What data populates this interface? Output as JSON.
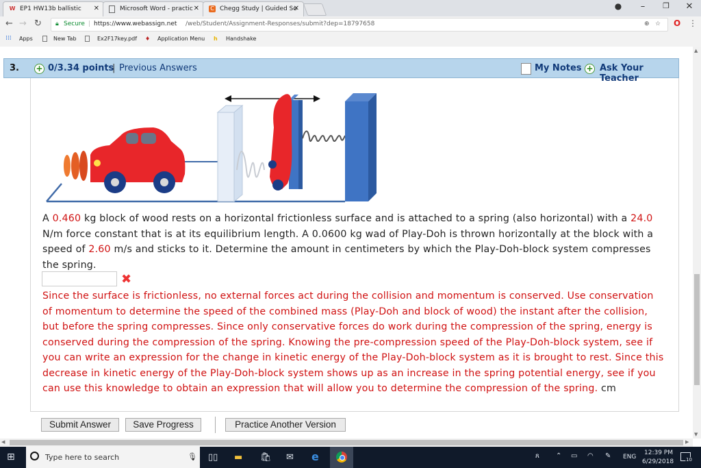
{
  "browser": {
    "tabs": [
      {
        "label": "EP1 HW13b ballistic",
        "icon": "webassign-icon"
      },
      {
        "label": "Microsoft Word - practic",
        "icon": "document-icon"
      },
      {
        "label": "Chegg Study | Guided So",
        "icon": "chegg-icon"
      }
    ],
    "secure_label": "Secure",
    "url_host": "https://www.webassign.net",
    "url_path": "/web/Student/Assignment-Responses/submit?dep=18797658",
    "bookmarks": [
      "Apps",
      "New Tab",
      "Ex2F17key.pdf",
      "Application Menu",
      "Handshake"
    ]
  },
  "question": {
    "number": "3.",
    "points": "0/3.34 points",
    "separator": "|",
    "previous_answers": "Previous Answers",
    "my_notes": "My Notes",
    "ask_teacher": "Ask Your Teacher",
    "problem_parts": [
      {
        "text": "A ",
        "highlight": false
      },
      {
        "text": "0.460",
        "highlight": true
      },
      {
        "text": " kg block of wood rests on a horizontal frictionless surface and is attached to a spring (also horizontal) with a ",
        "highlight": false
      },
      {
        "text": "24.0",
        "highlight": true
      },
      {
        "text": " N/m force constant that is at its equilibrium length. A 0.0600 kg wad of Play-Doh is thrown horizontally at the block with a speed of ",
        "highlight": false
      },
      {
        "text": "2.60",
        "highlight": true
      },
      {
        "text": " m/s and sticks to it. Determine the amount in centimeters by which the Play-Doh-block system compresses the spring.",
        "highlight": false
      }
    ],
    "answer_value": "",
    "feedback": "Since the surface is frictionless, no external forces act during the collision and momentum is conserved. Use conservation of momentum to determine the speed of the combined mass (Play-Doh and block of wood) the instant after the collision, but before the spring compresses. Since only conservative forces do work during the compression of the spring, energy is conserved during the compression of the spring. Knowing the pre-compression speed of the Play-Doh-block system, see if you can write an expression for the change in kinetic energy of the Play-Doh-block system as it is brought to rest. Since this decrease in kinetic energy of the Play-Doh-block system shows up as an increase in the spring potential energy, see if you can use this knowledge to obtain an expression that will allow you to determine the compression of the spring.",
    "unit": "cm"
  },
  "buttons": {
    "submit": "Submit Answer",
    "save": "Save Progress",
    "practice": "Practice Another Version"
  },
  "taskbar": {
    "search_placeholder": "Type here to search",
    "language": "ENG",
    "time": "12:39 PM",
    "date": "6/29/2018",
    "notification_count": "10"
  },
  "colors": {
    "accent_red": "#d01111",
    "header_blue": "#b7d5ec",
    "header_text": "#113a79",
    "block_blue": "#3f74c4"
  }
}
